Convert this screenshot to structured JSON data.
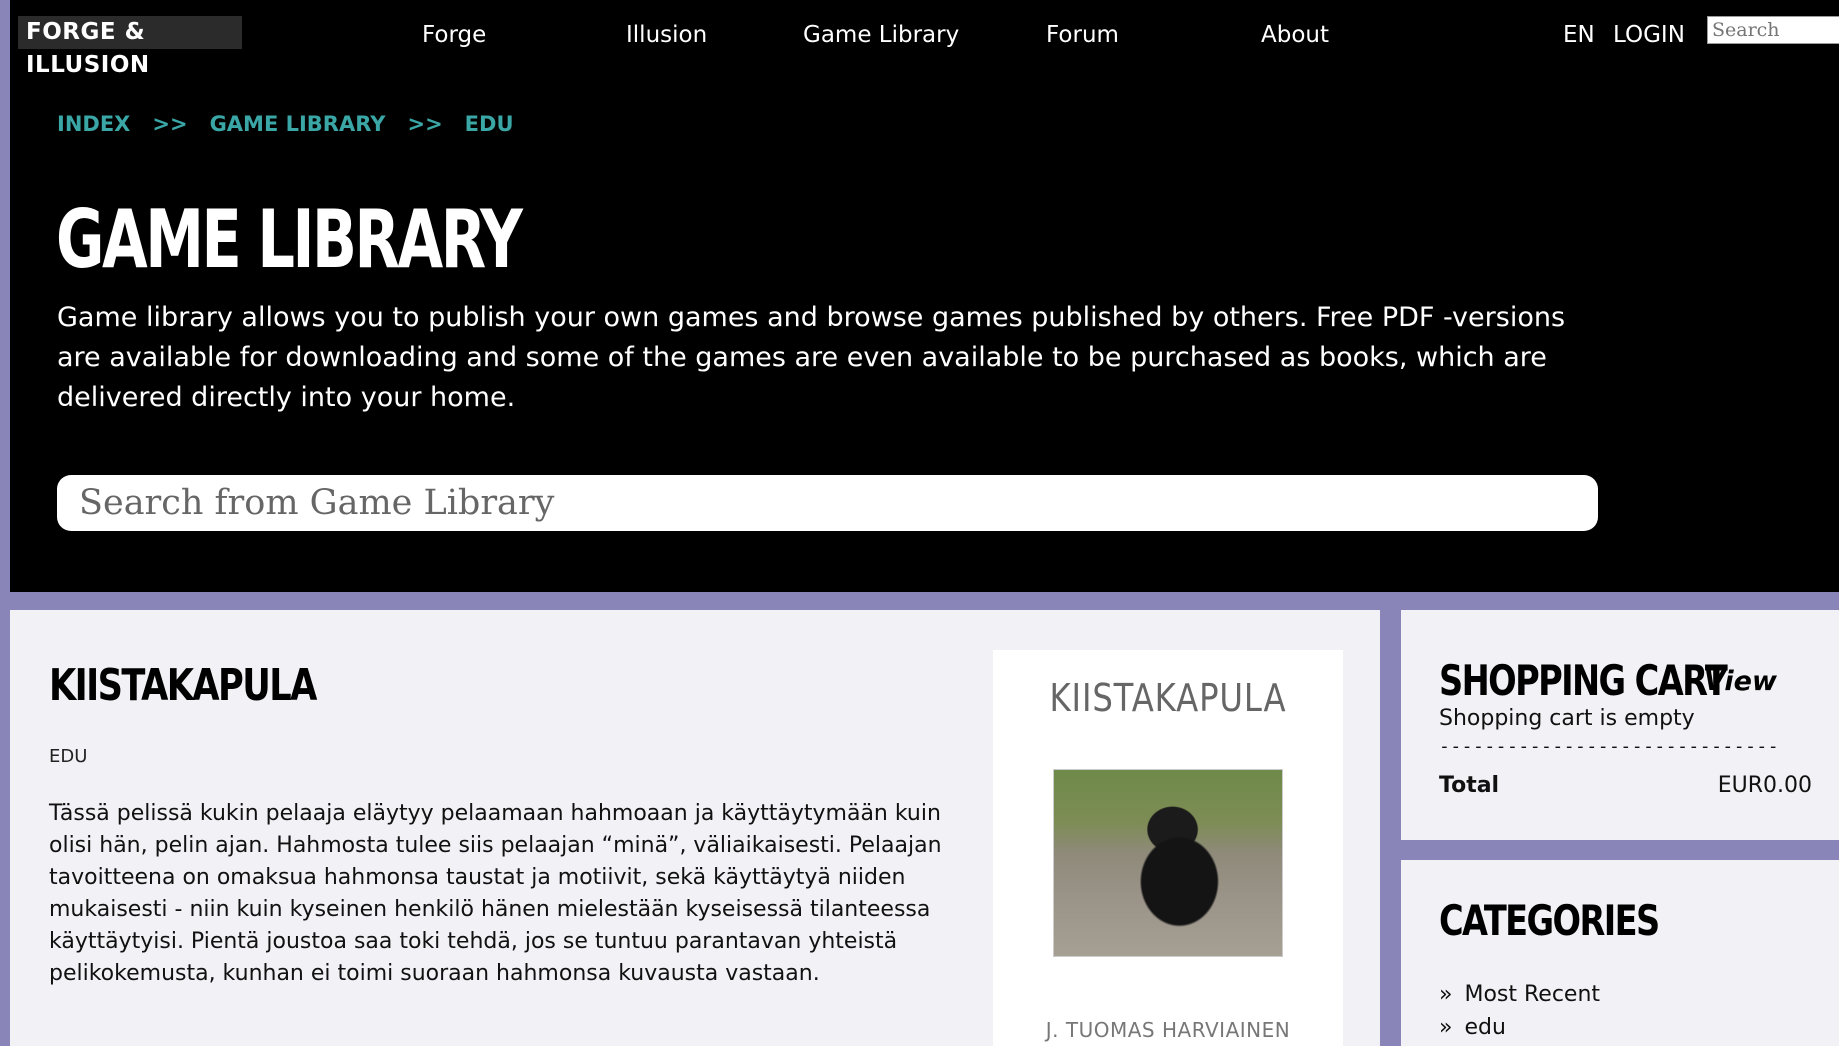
{
  "topnav": {
    "logo": "FORGE & ILLUSION",
    "links": [
      "Forge",
      "Illusion",
      "Game Library",
      "Forum",
      "About"
    ],
    "lang": "EN",
    "login": "LOGIN",
    "search_placeholder": "Search"
  },
  "hero": {
    "breadcrumb": [
      "INDEX",
      ">>",
      "GAME LIBRARY",
      ">>",
      "EDU"
    ],
    "title": "GAME LIBRARY",
    "description": "Game library allows you to publish your own games and browse games published by others. Free PDF -versions are available for downloading and some of the games are even available to be purchased as books, which are delivered directly into your home.",
    "search_placeholder": "Search from Game Library"
  },
  "game": {
    "title": "KIISTAKAPULA",
    "tag": "EDU",
    "description": "Tässä pelissä kukin pelaaja eläytyy pelaamaan hahmoaan ja käyttäytymään kuin olisi hän, pelin ajan. Hahmosta tulee siis pelaajan “minä”, väliaikaisesti. Pelaajan tavoitteena on omaksua hahmonsa taustat ja motiivit, sekä käyttäytyä niiden mukaisesti - niin kuin kyseinen henkilö hänen mielestään kyseisessä tilanteessa käyttäytyisi. Pientä joustoa saa toki tehdä, jos se tuntuu parantavan yhteistä pelikokemusta, kunhan ei toimi suoraan hahmonsa kuvausta vastaan.",
    "cover_title": "KIISTAKAPULA",
    "cover_author": "J. TUOMAS HARVIAINEN"
  },
  "cart": {
    "title": "SHOPPING CART",
    "view": "View",
    "empty": "Shopping cart is empty",
    "divider": "------------------------------",
    "total_label": "Total",
    "total_value": "EUR0.00"
  },
  "categories": {
    "title": "CATEGORIES",
    "bullet": "»",
    "items": [
      "Most Recent",
      "edu"
    ]
  },
  "colors": {
    "accent_teal": "#3aa6a6",
    "frame_purple": "#8a85b8",
    "panel_bg": "#f2f1f6"
  }
}
